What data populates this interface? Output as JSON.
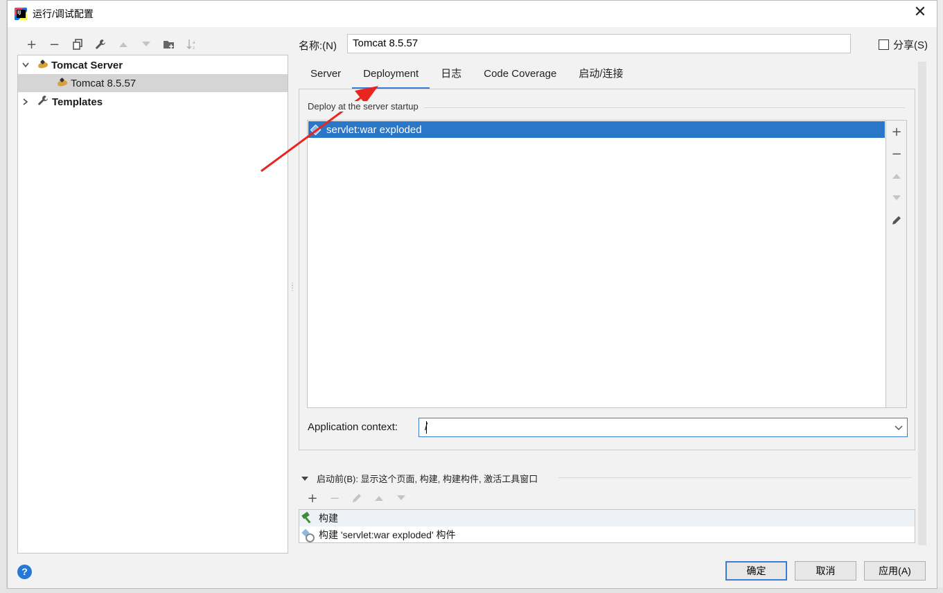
{
  "window": {
    "title": "运行/调试配置",
    "close_glyph": "✕"
  },
  "left_toolbar": {
    "add_icon": "plus-icon",
    "remove_icon": "minus-icon",
    "copy_icon": "copy-icon",
    "edit_defaults_icon": "wrench-icon",
    "move_up_icon": "triangle-up-icon",
    "move_down_icon": "triangle-down-icon",
    "folder_icon": "new-folder-icon",
    "sort_icon": "sort-az-icon"
  },
  "tree": {
    "group_label": "Tomcat Server",
    "child_label": "Tomcat 8.5.57",
    "templates_label": "Templates"
  },
  "form": {
    "name_label": "名称:(N)",
    "name_value": "Tomcat 8.5.57",
    "share_label": "分享(S)",
    "share_checked": false
  },
  "tabs": [
    {
      "label": "Server",
      "active": false
    },
    {
      "label": "Deployment",
      "active": true
    },
    {
      "label": "日志",
      "active": false
    },
    {
      "label": "Code Coverage",
      "active": false
    },
    {
      "label": "启动/连接",
      "active": false
    }
  ],
  "deployment": {
    "section_title": "Deploy at the server startup",
    "items": [
      "servlet:war exploded"
    ],
    "app_context_label": "Application context:",
    "app_context_value": "/"
  },
  "before_launch": {
    "title": "启动前(B): 显示这个页面, 构建, 构建构件, 激活工具窗口",
    "tasks": [
      "构建",
      "构建 'servlet:war exploded' 构件"
    ]
  },
  "buttons": {
    "ok": "确定",
    "cancel": "取消",
    "apply": "应用(A)",
    "help": "?"
  },
  "colors": {
    "selection": "#2a77c7",
    "accent": "#3a7bd5",
    "annotation_arrow": "#e8261f"
  }
}
